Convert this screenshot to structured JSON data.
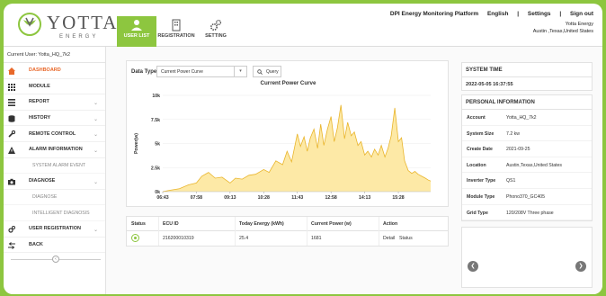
{
  "header": {
    "logo_text": "YOTTA",
    "logo_sub": "ENERGY",
    "nav": [
      {
        "label": "USER LIST",
        "icon": "user-icon",
        "active": true
      },
      {
        "label": "REGISTRATION",
        "icon": "building-icon",
        "active": false
      },
      {
        "label": "SETTING",
        "icon": "gears-icon",
        "active": false
      }
    ],
    "platform": "DPI Energy Monitoring Platform",
    "language": "English",
    "settings": "Settings",
    "sign_out": "Sign out",
    "company": "Yotta Energy",
    "location": "Austin ,Texas,United States",
    "accent": "#8dc63f"
  },
  "sidebar": {
    "current_user": "Current User: Yotta_HQ_7k2",
    "items": [
      {
        "label": "DASHBOARD",
        "icon": "home-icon",
        "active": true,
        "chevron": false
      },
      {
        "label": "MODULE",
        "icon": "grid-icon",
        "chevron": false
      },
      {
        "label": "REPORT",
        "icon": "list-icon",
        "chevron": true
      },
      {
        "label": "HISTORY",
        "icon": "database-icon",
        "chevron": true
      },
      {
        "label": "REMOTE CONTROL",
        "icon": "wrench-icon",
        "chevron": true
      },
      {
        "label": "ALARM INFORMATION",
        "icon": "warning-icon",
        "chevron": true
      },
      {
        "label": "SYSTEM ALARM EVENT",
        "sub": true
      },
      {
        "label": "DIAGNOSE",
        "icon": "camera-icon",
        "chevron": true
      },
      {
        "label": "DIAGNOSE",
        "sub": true
      },
      {
        "label": "INTELLIGENT DIAGNOSIS",
        "sub": true
      },
      {
        "label": "USER REGISTRATION",
        "icon": "gears-icon",
        "chevron": true
      },
      {
        "label": "BACK",
        "icon": "back-arrow-icon",
        "chevron": false
      }
    ]
  },
  "controls": {
    "data_type_label": "Data Type",
    "data_type_value": "Current Power Curve",
    "query_label": "Query"
  },
  "chart_data": {
    "type": "area",
    "title": "Current Power Curve",
    "ylabel": "Power(w)",
    "xlabel": "",
    "ylim": [
      0,
      10000
    ],
    "yticks": [
      "0k",
      "2.5k",
      "5k",
      "7.5k",
      "10k"
    ],
    "x_ticks": [
      "06:43",
      "07:58",
      "09:13",
      "10:28",
      "11:43",
      "12:58",
      "14:13",
      "15:28"
    ],
    "x_range": [
      "06:43",
      "16:40"
    ],
    "fill": "#fde9a6",
    "stroke": "#e9b52c",
    "x": [
      "06:43",
      "07:00",
      "07:20",
      "07:40",
      "07:58",
      "08:10",
      "08:25",
      "08:40",
      "08:55",
      "09:13",
      "09:25",
      "09:40",
      "09:55",
      "10:10",
      "10:28",
      "10:40",
      "10:55",
      "11:10",
      "11:20",
      "11:30",
      "11:43",
      "11:50",
      "11:58",
      "12:05",
      "12:12",
      "12:20",
      "12:28",
      "12:35",
      "12:42",
      "12:50",
      "12:58",
      "13:05",
      "13:12",
      "13:20",
      "13:28",
      "13:35",
      "13:43",
      "13:50",
      "13:58",
      "14:05",
      "14:13",
      "14:20",
      "14:28",
      "14:35",
      "14:43",
      "14:50",
      "14:58",
      "15:05",
      "15:12",
      "15:20",
      "15:28",
      "15:35",
      "15:42",
      "15:50",
      "15:58",
      "16:05",
      "16:12",
      "16:20",
      "16:28",
      "16:35",
      "16:40"
    ],
    "values": [
      0,
      150,
      300,
      700,
      900,
      1600,
      2000,
      1400,
      1500,
      900,
      1400,
      1300,
      1700,
      1800,
      2300,
      2000,
      3200,
      2800,
      4200,
      3100,
      6000,
      4700,
      5700,
      4200,
      5600,
      6500,
      4500,
      7000,
      4800,
      6500,
      7800,
      5200,
      6600,
      9000,
      5500,
      7200,
      5800,
      6200,
      4800,
      5200,
      3800,
      4200,
      3600,
      4400,
      3800,
      4800,
      3600,
      4500,
      5800,
      8700,
      5200,
      5600,
      3200,
      2200,
      1900,
      2100,
      1800,
      1600,
      1400,
      1200,
      1100
    ]
  },
  "table": {
    "headers": [
      "Status",
      "ECU ID",
      "Today Energy (kWh)",
      "Current Power (w)",
      "Action"
    ],
    "rows": [
      {
        "ecu_id": "216200010319",
        "today_energy": "25.4",
        "current_power": "1681",
        "detail": "Detail",
        "status_link": "Status"
      }
    ]
  },
  "system_time": {
    "title": "SYSTEM TIME",
    "value": "2022-05-05 16:37:55"
  },
  "personal_info": {
    "title": "PERSONAL INFORMATION",
    "rows": [
      {
        "label": "Account",
        "value": "Yotta_HQ_7k2"
      },
      {
        "label": "System Size",
        "value": "7.2 kw"
      },
      {
        "label": "Create Date",
        "value": "2021-09-25"
      },
      {
        "label": "Location",
        "value": "Austin,Texas,United States"
      },
      {
        "label": "Inverter Type",
        "value": "QS1"
      },
      {
        "label": "Module Type",
        "value": "Phono370_GC405"
      },
      {
        "label": "Grid Type",
        "value": "120/208V Three phase"
      }
    ]
  },
  "carousel": {
    "prev_icon": "chevron-left-icon",
    "next_icon": "chevron-right-icon"
  }
}
